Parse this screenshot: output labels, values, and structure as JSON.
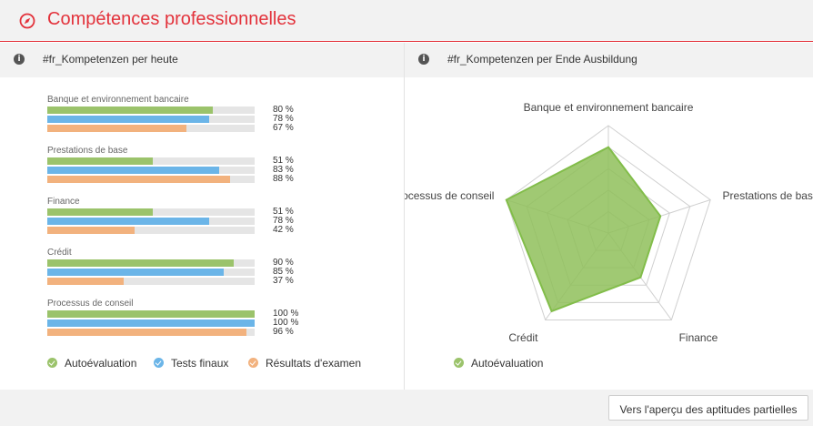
{
  "header": {
    "title": "Compétences professionnelles",
    "icon": "compass-icon",
    "accent": "#e3323b"
  },
  "left_panel": {
    "title": "#fr_Kompetenzen per heute",
    "groups": [
      {
        "name": "Banque et environnement bancaire",
        "values": [
          80,
          78,
          67
        ],
        "labels": [
          "80 %",
          "78 %",
          "67 %"
        ]
      },
      {
        "name": "Prestations de base",
        "values": [
          51,
          83,
          88
        ],
        "labels": [
          "51 %",
          "83 %",
          "88 %"
        ]
      },
      {
        "name": "Finance",
        "values": [
          51,
          78,
          42
        ],
        "labels": [
          "51 %",
          "78 %",
          "42 %"
        ]
      },
      {
        "name": "Crédit",
        "values": [
          90,
          85,
          37
        ],
        "labels": [
          "90 %",
          "85 %",
          "37 %"
        ]
      },
      {
        "name": "Processus de conseil",
        "values": [
          100,
          100,
          96
        ],
        "labels": [
          "100 %",
          "100 %",
          "96 %"
        ]
      }
    ],
    "legend": [
      {
        "label": "Autoévaluation",
        "color": "#9bc36b"
      },
      {
        "label": "Tests finaux",
        "color": "#6bb5e8"
      },
      {
        "label": "Résultats d'examen",
        "color": "#f2b27e"
      }
    ]
  },
  "right_panel": {
    "title": "#fr_Kompetenzen per Ende Ausbildung",
    "legend": [
      {
        "label": "Autoévaluation",
        "color": "#9bc36b"
      }
    ]
  },
  "chart_data": [
    {
      "type": "bar",
      "categories": [
        "Banque et environnement bancaire",
        "Prestations de base",
        "Finance",
        "Crédit",
        "Processus de conseil"
      ],
      "series": [
        {
          "name": "Autoévaluation",
          "values": [
            80,
            51,
            51,
            90,
            100
          ]
        },
        {
          "name": "Tests finaux",
          "values": [
            78,
            83,
            78,
            85,
            100
          ]
        },
        {
          "name": "Résultats d'examen",
          "values": [
            67,
            88,
            42,
            37,
            96
          ]
        }
      ],
      "orientation": "horizontal",
      "ylim": [
        0,
        100
      ],
      "legend": "bottom"
    },
    {
      "type": "radar",
      "categories": [
        "Banque et environnement bancaire",
        "Prestations de base",
        "Finance",
        "Crédit",
        "Processus de conseil"
      ],
      "series": [
        {
          "name": "Autoévaluation",
          "values": [
            80,
            51,
            51,
            90,
            100
          ]
        }
      ],
      "range": [
        0,
        100
      ],
      "grid_levels": 5,
      "legend": "bottom"
    }
  ],
  "footer": {
    "button_label": "Vers l'aperçu des aptitudes partielles"
  }
}
